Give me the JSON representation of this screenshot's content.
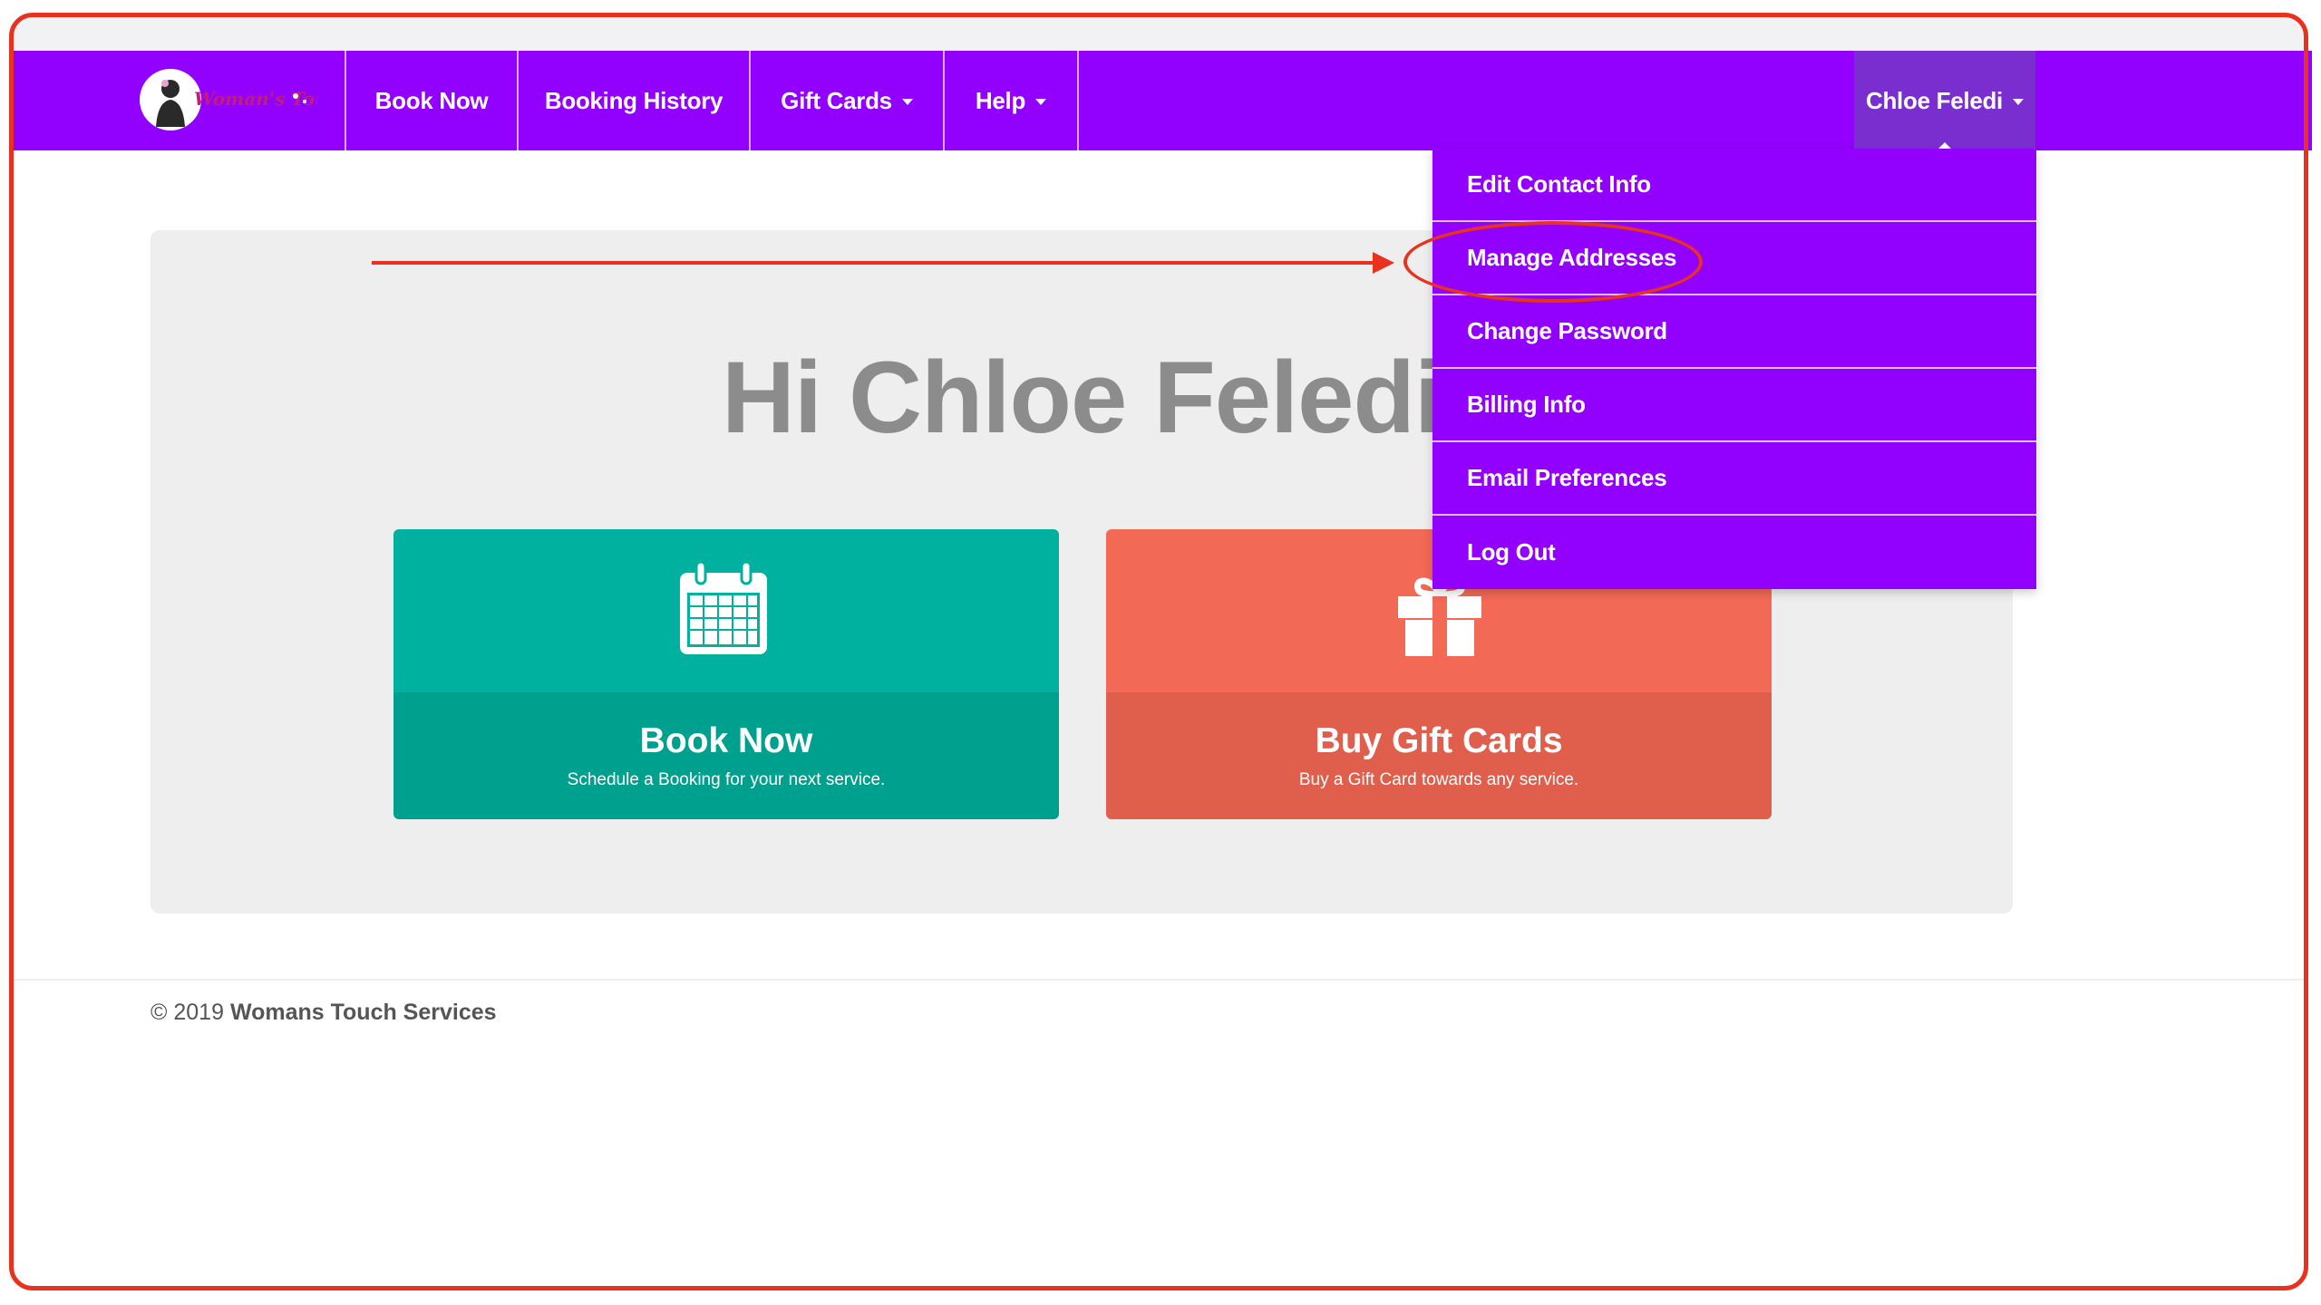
{
  "navbar": {
    "logo_text": "Woman's Touch",
    "items": [
      {
        "label": "Book Now"
      },
      {
        "label": "Booking History"
      },
      {
        "label": "Gift Cards"
      },
      {
        "label": "Help"
      }
    ],
    "user_name": "Chloe Feledi"
  },
  "user_menu": {
    "items": [
      {
        "label": "Edit Contact Info"
      },
      {
        "label": "Manage Addresses"
      },
      {
        "label": "Change Password"
      },
      {
        "label": "Billing Info"
      },
      {
        "label": "Email Preferences"
      },
      {
        "label": "Log Out"
      }
    ]
  },
  "main": {
    "greeting": "Hi Chloe Feledi",
    "cards": [
      {
        "title": "Book Now",
        "subtitle": "Schedule a Booking for your next service.",
        "icon": "calendar-icon"
      },
      {
        "title": "Buy Gift Cards",
        "subtitle": "Buy a Gift Card towards any service.",
        "icon": "gift-icon"
      }
    ]
  },
  "footer": {
    "copyright": "© 2019",
    "company": "Womans Touch Services"
  },
  "colors": {
    "nav_purple": "#9101fd",
    "user_active": "#7a2ed0",
    "teal": "#00b19f",
    "coral": "#f26955",
    "annotation_red": "#e8321e"
  }
}
